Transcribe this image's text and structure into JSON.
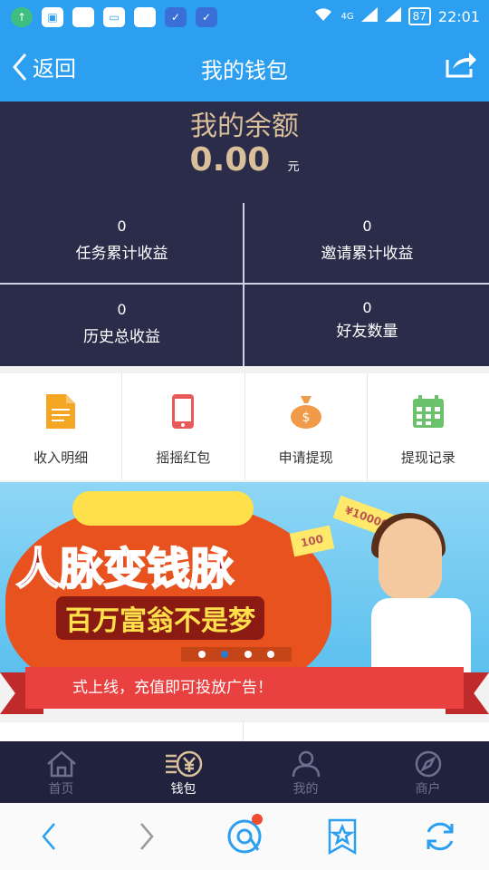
{
  "status_bar": {
    "network": "4G",
    "battery": "87",
    "time": "22:01"
  },
  "header": {
    "back_label": "返回",
    "title": "我的钱包"
  },
  "balance": {
    "title": "我的余额",
    "amount": "0.00",
    "unit": "元"
  },
  "stats": [
    {
      "value": "0",
      "label": "任务累计收益"
    },
    {
      "value": "0",
      "label": "邀请累计收益"
    },
    {
      "value": "0",
      "label": "历史总收益"
    },
    {
      "value": "0",
      "label": "好友数量"
    }
  ],
  "menu": [
    {
      "label": "收入明细",
      "icon": "document-icon",
      "color": "#f5a623"
    },
    {
      "label": "摇摇红包",
      "icon": "phone-icon",
      "color": "#e85a5a"
    },
    {
      "label": "申请提现",
      "icon": "money-bag-icon",
      "color": "#f09b4a"
    },
    {
      "label": "提现记录",
      "icon": "calendar-icon",
      "color": "#6cc26c"
    }
  ],
  "banner": {
    "headline": "人脉变钱脉",
    "subline": "百万富翁不是梦",
    "note_1": "¥10000",
    "note_2": "100",
    "slide_count": 4,
    "active_slide": 2
  },
  "marquee": "式上线，充值即可投放广告！",
  "tabs": [
    {
      "label": "首页",
      "icon": "home-icon",
      "active": false
    },
    {
      "label": "钱包",
      "icon": "wallet-icon",
      "active": true
    },
    {
      "label": "我的",
      "icon": "user-icon",
      "active": false
    },
    {
      "label": "商户",
      "icon": "compass-icon",
      "active": false
    }
  ],
  "colors": {
    "primary": "#2c9ff0",
    "panel": "#2a2c4a",
    "gold": "#d9bf9a",
    "tabbar": "#20223e",
    "ribbon": "#e94040"
  }
}
